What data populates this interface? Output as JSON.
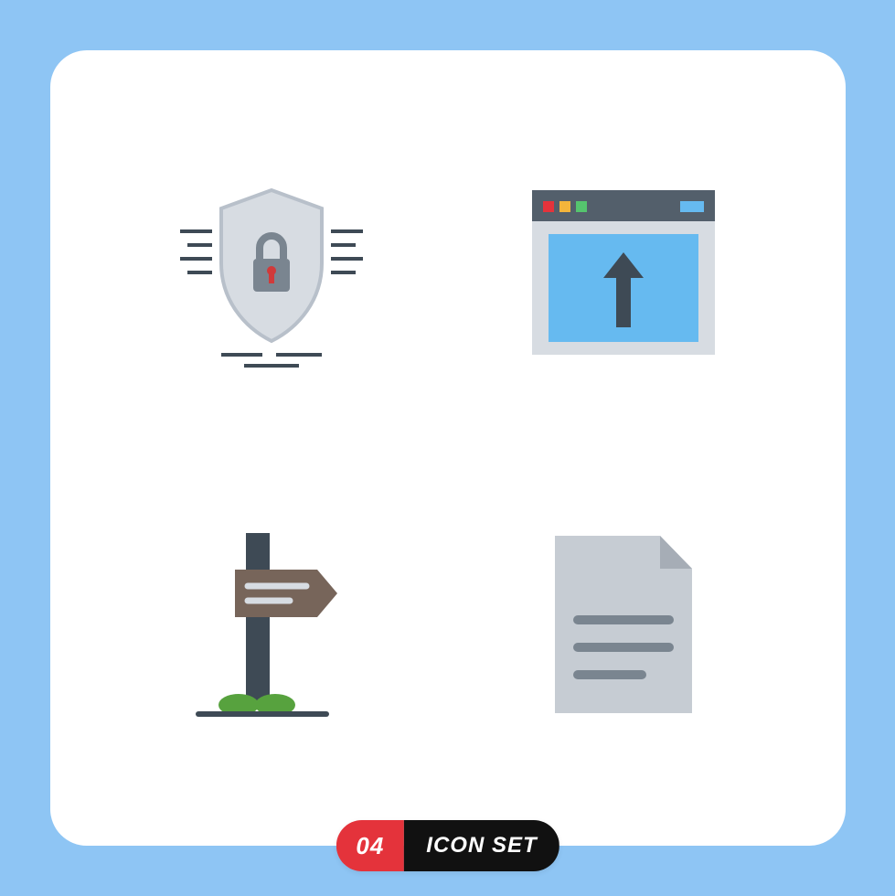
{
  "badge": {
    "number": "04",
    "label": "ICON SET"
  },
  "icons": [
    {
      "name": "shield-lock-icon"
    },
    {
      "name": "browser-upload-icon"
    },
    {
      "name": "signpost-icon"
    },
    {
      "name": "file-document-icon"
    }
  ],
  "colors": {
    "background": "#8ec5f4",
    "card": "#ffffff",
    "badge_red": "#e4333b",
    "badge_black": "#111111"
  }
}
